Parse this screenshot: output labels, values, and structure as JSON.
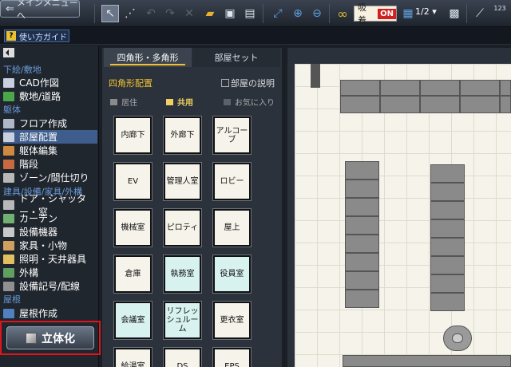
{
  "toolbar": {
    "main_menu_label": "メインメニューへ",
    "snap_label": "吸着",
    "snap_state": "ON",
    "grid_ratio": "1/2",
    "counter": "123"
  },
  "guide": {
    "label": "使い方ガイド"
  },
  "sidebar": {
    "sections": [
      {
        "label": "下絵/敷地"
      },
      {
        "label": "躯体"
      },
      {
        "label": "建具/設備/家具/外構"
      },
      {
        "label": "屋根"
      }
    ],
    "items": [
      {
        "label": "CAD作図",
        "color": "#c8d0e0"
      },
      {
        "label": "敷地/道路",
        "color": "#4aa84a"
      },
      {
        "label": "フロア作成",
        "color": "#b0b8c8"
      },
      {
        "label": "部屋配置",
        "color": "#c8d0e0"
      },
      {
        "label": "躯体編集",
        "color": "#d08a40"
      },
      {
        "label": "階段",
        "color": "#c86a40"
      },
      {
        "label": "ゾーン/間仕切り",
        "color": "#b8b8b8"
      },
      {
        "label": "ドア・シャッター・窓",
        "color": "#b8b8b8"
      },
      {
        "label": "カーテン",
        "color": "#70b070"
      },
      {
        "label": "設備機器",
        "color": "#c8c8c8"
      },
      {
        "label": "家具・小物",
        "color": "#d0a060"
      },
      {
        "label": "照明・天井器具",
        "color": "#e0c060"
      },
      {
        "label": "外構",
        "color": "#60a060"
      },
      {
        "label": "設備記号/配線",
        "color": "#909090"
      },
      {
        "label": "屋根作成",
        "color": "#5080c0"
      }
    ],
    "solid_button": "立体化"
  },
  "panel": {
    "tabs": [
      {
        "label": "四角形・多角形"
      },
      {
        "label": "部屋セット"
      }
    ],
    "subtitle": "四角形配置",
    "description_checkbox": "部屋の説明",
    "filters": [
      {
        "label": "居住",
        "color": "#8a8a8a"
      },
      {
        "label": "共用",
        "color": "#f0d060"
      },
      {
        "label": "お気に入り",
        "color": "#5a626c"
      }
    ],
    "rooms": [
      {
        "label": "内廊下",
        "cyan": false
      },
      {
        "label": "外廊下",
        "cyan": false
      },
      {
        "label": "アルコーブ",
        "cyan": false
      },
      {
        "label": "EV",
        "cyan": false
      },
      {
        "label": "管理人室",
        "cyan": false
      },
      {
        "label": "ロビー",
        "cyan": false
      },
      {
        "label": "機械室",
        "cyan": false
      },
      {
        "label": "ピロティ",
        "cyan": false
      },
      {
        "label": "屋上",
        "cyan": false
      },
      {
        "label": "倉庫",
        "cyan": false
      },
      {
        "label": "執務室",
        "cyan": true
      },
      {
        "label": "役員室",
        "cyan": true
      },
      {
        "label": "会議室",
        "cyan": true
      },
      {
        "label": "リフレッシュルーム",
        "cyan": true
      },
      {
        "label": "更衣室",
        "cyan": false
      },
      {
        "label": "給湯室",
        "cyan": false
      },
      {
        "label": "DS",
        "cyan": false
      },
      {
        "label": "EPS",
        "cyan": false
      }
    ]
  }
}
